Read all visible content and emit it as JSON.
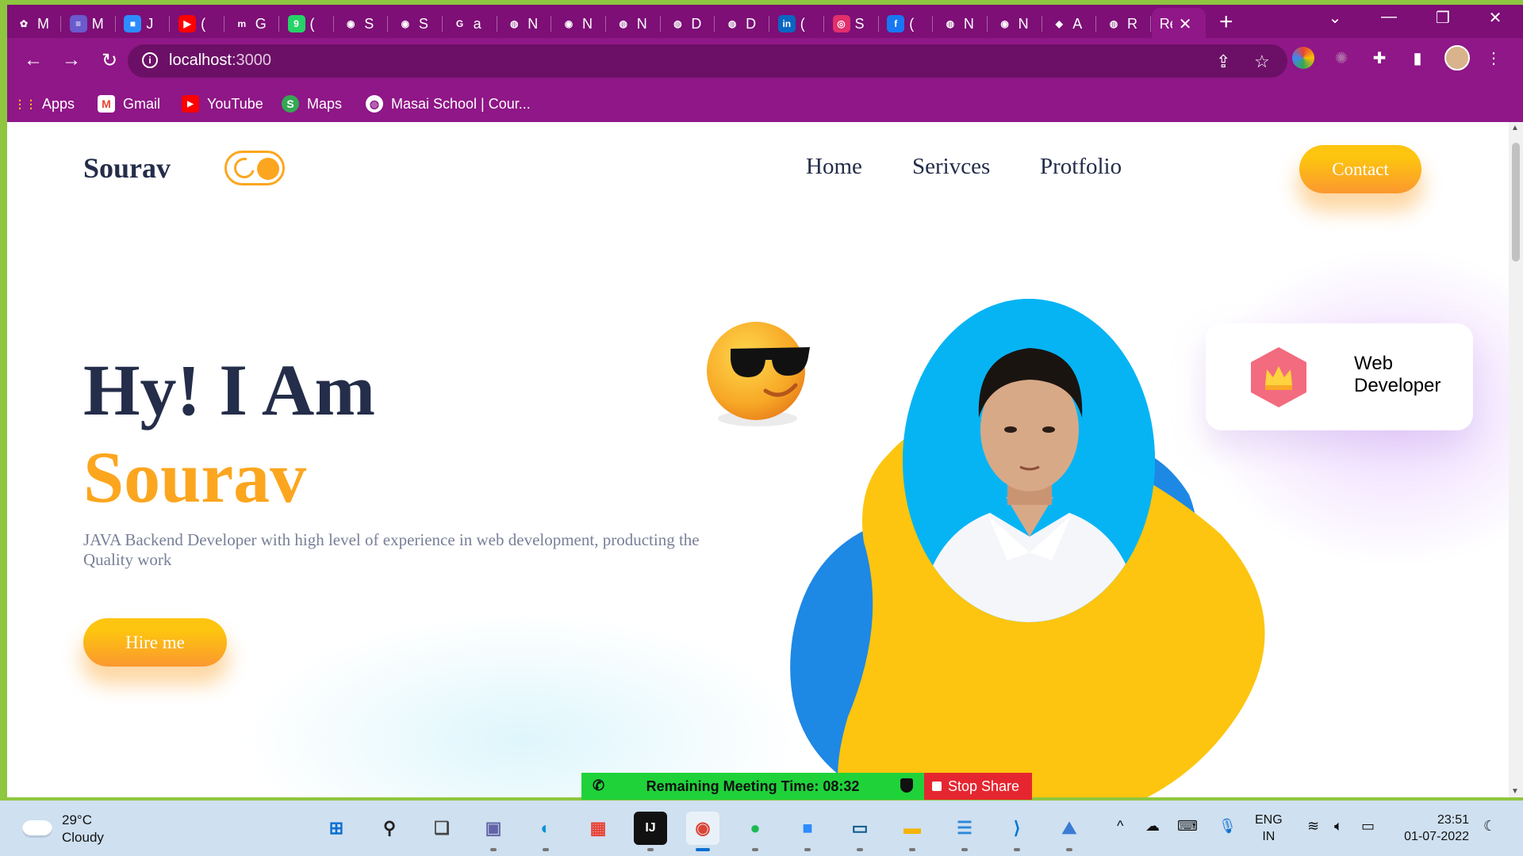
{
  "browser": {
    "tabs": [
      {
        "label": "M",
        "icon": "colorful-logo-icon",
        "color": "#e94235"
      },
      {
        "label": "M",
        "icon": "list-icon",
        "color": "#6a5acd"
      },
      {
        "label": "J",
        "icon": "zoom-icon",
        "color": "#2d8cff"
      },
      {
        "label": "(",
        "icon": "youtube-icon",
        "color": "#ff0000"
      },
      {
        "label": "G",
        "icon": "mg-icon",
        "color": "#ffffff"
      },
      {
        "label": "(",
        "icon": "whatsapp-icon",
        "color": "#25d366"
      },
      {
        "label": "S",
        "icon": "github-icon",
        "color": "#ffffff"
      },
      {
        "label": "S",
        "icon": "github-icon",
        "color": "#ffffff"
      },
      {
        "label": "a",
        "icon": "google-icon",
        "color": "#ffffff"
      },
      {
        "label": "N",
        "icon": "globe-icon",
        "color": "#ffffff"
      },
      {
        "label": "N",
        "icon": "chrome-icon",
        "color": "#ffffff"
      },
      {
        "label": "N",
        "icon": "globe-icon",
        "color": "#ffffff"
      },
      {
        "label": "D",
        "icon": "globe-icon",
        "color": "#ffffff"
      },
      {
        "label": "D",
        "icon": "globe-icon",
        "color": "#ffffff"
      },
      {
        "label": "(",
        "icon": "linkedin-icon",
        "color": "#0a66c2"
      },
      {
        "label": "S",
        "icon": "instagram-icon",
        "color": "#e1306c"
      },
      {
        "label": "(",
        "icon": "facebook-icon",
        "color": "#1877f2"
      },
      {
        "label": "N",
        "icon": "globe-icon",
        "color": "#ffffff"
      },
      {
        "label": "N",
        "icon": "chrome-icon",
        "color": "#ffffff"
      },
      {
        "label": "A",
        "icon": "diamond-icon",
        "color": "#18b89b"
      },
      {
        "label": "R",
        "icon": "globe-icon",
        "color": "#ffffff"
      },
      {
        "label": "Re",
        "icon": "none",
        "color": "#ffffff",
        "active": true
      }
    ],
    "new_tab": "+",
    "url_host": "localhost",
    "url_port": ":3000",
    "bookmarks": [
      {
        "label": "Apps",
        "icon": "apps-grid-icon"
      },
      {
        "label": "Gmail",
        "icon": "gmail-icon"
      },
      {
        "label": "YouTube",
        "icon": "youtube-icon"
      },
      {
        "label": "Maps",
        "icon": "maps-icon"
      },
      {
        "label": "Masai School | Cour...",
        "icon": "globe-icon"
      }
    ]
  },
  "site": {
    "brand": "Sourav",
    "nav": [
      "Home",
      "Serivces",
      "Protfolio"
    ],
    "contact": "Contact",
    "hero_line1": "Hy! I Am",
    "hero_line2": "Sourav",
    "description": "JAVA Backend Developer with high level of experience in web development, producting the Quality work",
    "hire": "Hire me",
    "badge_line1": "Web",
    "badge_line2": "Developer",
    "colors": {
      "accent": "#fca61f",
      "dark": "#242d49",
      "blob_yellow": "#fdc50f",
      "blob_blue": "#1e88e5"
    }
  },
  "meeting": {
    "remaining": "Remaining Meeting Time: 08:32",
    "stop": "Stop Share"
  },
  "taskbar": {
    "temperature": "29°C",
    "weather": "Cloudy",
    "lang1": "ENG",
    "lang2": "IN",
    "time": "23:51",
    "date": "01-07-2022"
  }
}
